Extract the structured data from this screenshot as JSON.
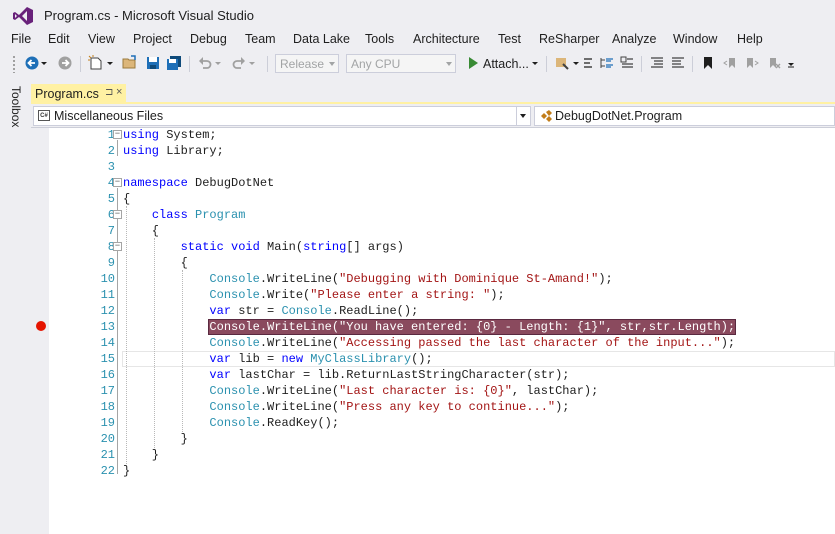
{
  "window": {
    "title": "Program.cs - Microsoft Visual Studio"
  },
  "menu": [
    "File",
    "Edit",
    "View",
    "Project",
    "Debug",
    "Team",
    "Data Lake",
    "Tools",
    "Architecture",
    "Test",
    "ReSharper",
    "Analyze",
    "Window",
    "Help"
  ],
  "toolbar": {
    "config": "Release",
    "platform": "Any CPU",
    "attach_label": "Attach..."
  },
  "toolbox": {
    "label": "Toolbox"
  },
  "tab": {
    "label": "Program.cs",
    "pin": "⊐",
    "close": "×"
  },
  "nav": {
    "project": "Miscellaneous Files",
    "type": "DebugDotNet.Program"
  },
  "code": {
    "lines": [
      {
        "n": "1",
        "t": "using System;"
      },
      {
        "n": "2",
        "t": "using Library;"
      },
      {
        "n": "3",
        "t": ""
      },
      {
        "n": "4",
        "t": "namespace DebugDotNet"
      },
      {
        "n": "5",
        "t": "{"
      },
      {
        "n": "6",
        "t": "    class Program"
      },
      {
        "n": "7",
        "t": "    {"
      },
      {
        "n": "8",
        "t": "        static void Main(string[] args)"
      },
      {
        "n": "9",
        "t": "        {"
      },
      {
        "n": "10",
        "t": "            Console.WriteLine(\"Debugging with Dominique St-Amand!\");"
      },
      {
        "n": "11",
        "t": "            Console.Write(\"Please enter a string: \");"
      },
      {
        "n": "12",
        "t": "            var str = Console.ReadLine();"
      },
      {
        "n": "13",
        "t": "            Console.WriteLine(\"You have entered: {0} - Length: {1}\", str,str.Length);"
      },
      {
        "n": "14",
        "t": "            Console.WriteLine(\"Accessing passed the last character of the input...\");"
      },
      {
        "n": "15",
        "t": "            var lib = new MyClassLibrary();"
      },
      {
        "n": "16",
        "t": "            var lastChar = lib.ReturnLastStringCharacter(str);"
      },
      {
        "n": "17",
        "t": "            Console.WriteLine(\"Last character is: {0}\", lastChar);"
      },
      {
        "n": "18",
        "t": "            Console.WriteLine(\"Press any key to continue...\");"
      },
      {
        "n": "19",
        "t": "            Console.ReadKey();"
      },
      {
        "n": "20",
        "t": "        }"
      },
      {
        "n": "21",
        "t": "    }"
      },
      {
        "n": "22",
        "t": "}"
      }
    ],
    "breakpoint_line": "13",
    "caret_line": "15"
  },
  "colors": {
    "accent": "#68217a",
    "tab_active": "#fff1a3",
    "breakpoint": "#e51400",
    "keyword": "#0000ff",
    "type": "#2b91af",
    "string": "#a31515"
  },
  "icons": [
    "visual-studio-logo-icon",
    "back-icon",
    "forward-icon",
    "new-project-icon",
    "open-icon",
    "save-icon",
    "save-all-icon",
    "undo-icon",
    "redo-icon",
    "start-icon",
    "bookmark-icon"
  ]
}
